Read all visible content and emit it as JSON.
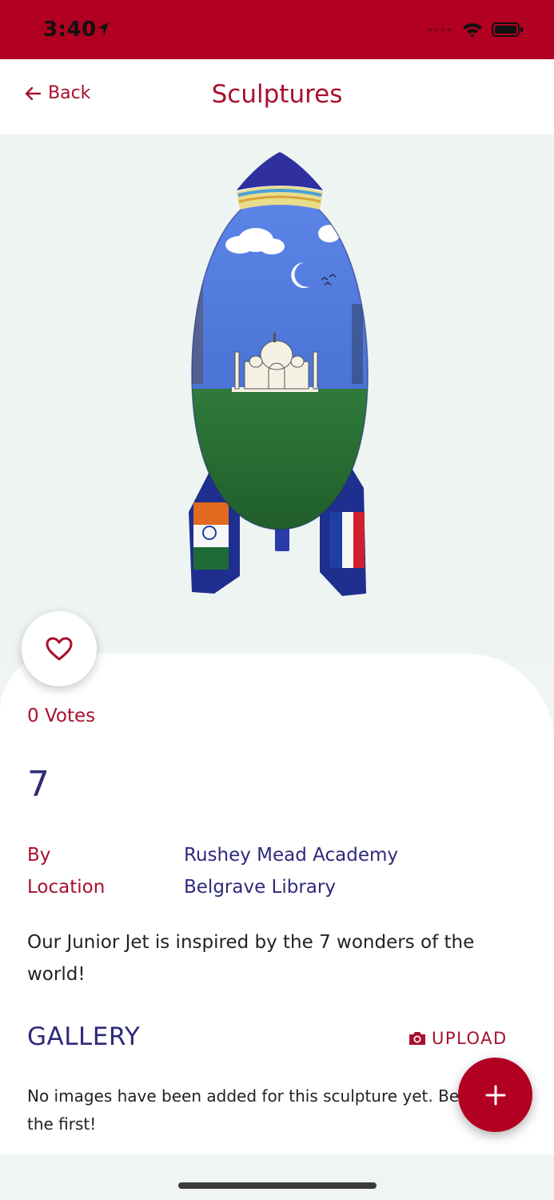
{
  "status_bar": {
    "time": "3:40"
  },
  "nav": {
    "back_label": "Back",
    "title": "Sculptures"
  },
  "sculpture": {
    "votes_text": "0 Votes",
    "number": "7",
    "by_label": "By",
    "by_value": "Rushey Mead Academy",
    "location_label": "Location",
    "location_value": "Belgrave Library",
    "description": "Our Junior Jet is inspired by the 7 wonders of the world!"
  },
  "gallery": {
    "heading": "GALLERY",
    "upload_label": "UPLOAD",
    "empty_text": "No images have been added for this sculpture yet. Be the first!"
  },
  "icons": {
    "back": "arrow-left-icon",
    "favorite": "heart-outline-icon",
    "upload": "camera-icon",
    "add": "plus-icon"
  },
  "colors": {
    "brand_red": "#b10022",
    "accent_text": "#a8102e",
    "heading_navy": "#2e2a7a",
    "hero_bg": "#eef4f2"
  }
}
